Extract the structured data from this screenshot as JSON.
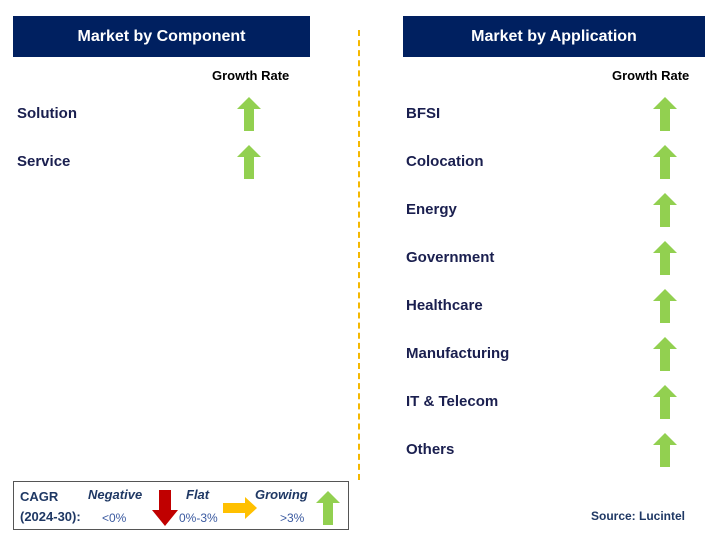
{
  "colors": {
    "header_bg": "#002060",
    "up": "#92d050",
    "down": "#c00000",
    "flat": "#ffc000",
    "divider": "#f5b800"
  },
  "left": {
    "title": "Market by Component",
    "growth_label": "Growth Rate",
    "items": [
      {
        "label": "Solution",
        "trend": "growing",
        "icon": "arrow-up-icon"
      },
      {
        "label": "Service",
        "trend": "growing",
        "icon": "arrow-up-icon"
      }
    ]
  },
  "right": {
    "title": "Market by Application",
    "growth_label": "Growth Rate",
    "items": [
      {
        "label": "BFSI",
        "trend": "growing",
        "icon": "arrow-up-icon"
      },
      {
        "label": "Colocation",
        "trend": "growing",
        "icon": "arrow-up-icon"
      },
      {
        "label": "Energy",
        "trend": "growing",
        "icon": "arrow-up-icon"
      },
      {
        "label": "Government",
        "trend": "growing",
        "icon": "arrow-up-icon"
      },
      {
        "label": "Healthcare",
        "trend": "growing",
        "icon": "arrow-up-icon"
      },
      {
        "label": "Manufacturing",
        "trend": "growing",
        "icon": "arrow-up-icon"
      },
      {
        "label": "IT & Telecom",
        "trend": "growing",
        "icon": "arrow-up-icon"
      },
      {
        "label": "Others",
        "trend": "growing",
        "icon": "arrow-up-icon"
      }
    ]
  },
  "legend": {
    "cagr_line1": "CAGR",
    "cagr_line2": "(2024-30):",
    "negative": {
      "label": "Negative",
      "range": "<0%",
      "icon": "arrow-down-icon"
    },
    "flat": {
      "label": "Flat",
      "range": "0%-3%",
      "icon": "arrow-right-icon"
    },
    "growing": {
      "label": "Growing",
      "range": ">3%",
      "icon": "arrow-up-icon"
    }
  },
  "source": "Source: Lucintel"
}
